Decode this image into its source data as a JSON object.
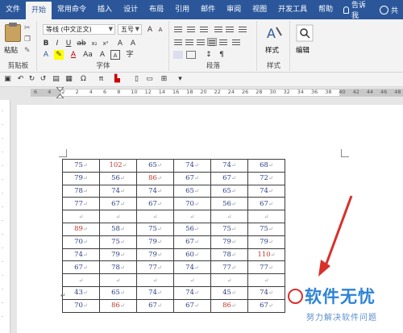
{
  "tabs": [
    "文件",
    "开始",
    "常用命令",
    "插入",
    "设计",
    "布局",
    "引用",
    "邮件",
    "审阅",
    "视图",
    "开发工具",
    "帮助"
  ],
  "active_tab": "开始",
  "tell_me": "告诉我",
  "share": "共",
  "ribbon": {
    "clipboard": {
      "paste_label": "粘贴",
      "group_label": "剪贴板"
    },
    "font": {
      "font_name": "等线 (中文正文)",
      "font_size": "五号",
      "group_label": "字体"
    },
    "paragraph": {
      "group_label": "段落"
    },
    "styles": {
      "label": "样式",
      "group_label": "样式"
    },
    "editing": {
      "label": "编辑"
    }
  },
  "ruler": {
    "numbers": [
      "6",
      "4",
      "2",
      "2",
      "4",
      "6",
      "8",
      "10",
      "12",
      "14",
      "16",
      "18",
      "20",
      "22",
      "24",
      "26",
      "28",
      "30",
      "32",
      "34",
      "36",
      "38",
      "40",
      "42",
      "44",
      "46",
      "48"
    ]
  },
  "table": {
    "cell_mark": "↵",
    "rows": [
      [
        "75",
        "102",
        "65",
        "74",
        "74",
        "68"
      ],
      [
        "79",
        "56",
        "86",
        "67",
        "67",
        "72"
      ],
      [
        "78",
        "74",
        "74",
        "65",
        "65",
        "74"
      ],
      [
        "77",
        "67",
        "67",
        "70",
        "56",
        "67"
      ],
      [
        "",
        "",
        "",
        "",
        "",
        ""
      ],
      [
        "89",
        "58",
        "75",
        "56",
        "75",
        "75"
      ],
      [
        "70",
        "75",
        "79",
        "67",
        "79",
        "79"
      ],
      [
        "74",
        "79",
        "79",
        "60",
        "78",
        "110"
      ],
      [
        "67",
        "78",
        "77",
        "74",
        "77",
        "77"
      ],
      [
        "",
        "",
        "",
        "",
        "",
        ""
      ],
      [
        "43",
        "65",
        "74",
        "74",
        "45",
        "74"
      ],
      [
        "70",
        "86",
        "67",
        "67",
        "86",
        "67"
      ]
    ],
    "red_cells": [
      [
        0,
        1
      ],
      [
        1,
        2
      ],
      [
        5,
        0
      ],
      [
        7,
        5
      ],
      [
        11,
        1
      ],
      [
        11,
        4
      ]
    ]
  },
  "watermark": {
    "title": "软件无忧",
    "subtitle": "努力解决软件问题"
  },
  "colors": {
    "ribbon_blue": "#2b579a",
    "arrow_red": "#d9302a",
    "watermark_blue": "#2d83d6"
  }
}
